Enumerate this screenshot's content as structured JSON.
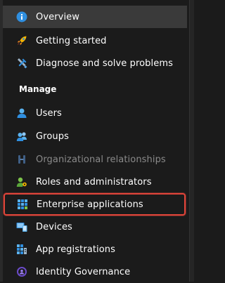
{
  "nav": {
    "items": [
      {
        "label": "Overview"
      },
      {
        "label": "Getting started"
      },
      {
        "label": "Diagnose and solve problems"
      }
    ],
    "section_label": "Manage",
    "manage_items": [
      {
        "label": "Users"
      },
      {
        "label": "Groups"
      },
      {
        "label": "Organizational relationships"
      },
      {
        "label": "Roles and administrators"
      },
      {
        "label": "Enterprise applications"
      },
      {
        "label": "Devices"
      },
      {
        "label": "App registrations"
      },
      {
        "label": "Identity Governance"
      }
    ]
  },
  "colors": {
    "background": "#1b1b1b",
    "selected_background": "#3a3a3a",
    "highlight_outline": "#e0453a",
    "disabled_text": "#8a8a8a",
    "icon_blue": "#2f8fe0"
  }
}
